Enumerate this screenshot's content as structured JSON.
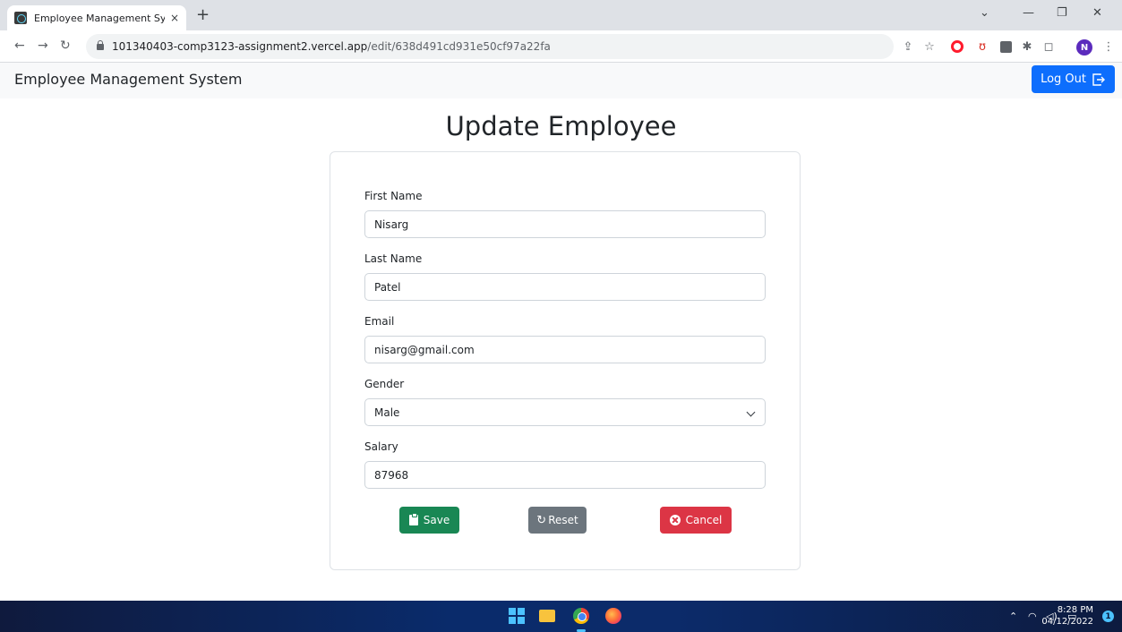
{
  "browser": {
    "tab_title": "Employee Management System",
    "tab_close": "×",
    "new_tab": "+",
    "url_host": "101340403-comp3123-assignment2.vercel.app",
    "url_path": "/edit/638d491cd931e50cf97a22fa",
    "profile_initial": "N",
    "icons": [
      "react-favicon-icon",
      "lock-icon",
      "share-icon",
      "star-icon",
      "opera-icon",
      "extension-icon",
      "puzzle-icon",
      "sidebar-icon"
    ]
  },
  "navbar": {
    "brand": "Employee Management System",
    "logout_label": "Log Out",
    "logout_color": "#0d6efd"
  },
  "page": {
    "title": "Update Employee"
  },
  "form": {
    "first_name": {
      "label": "First Name",
      "value": "Nisarg"
    },
    "last_name": {
      "label": "Last Name",
      "value": "Patel"
    },
    "email": {
      "label": "Email",
      "value": "nisarg@gmail.com"
    },
    "gender": {
      "label": "Gender",
      "value": "Male"
    },
    "salary": {
      "label": "Salary",
      "value": "87968"
    }
  },
  "buttons": {
    "save": {
      "label": "Save",
      "color": "#198754"
    },
    "reset": {
      "label": "Reset",
      "color": "#6c757d"
    },
    "cancel": {
      "label": "Cancel",
      "color": "#dc3545"
    }
  },
  "taskbar": {
    "time": "8:28 PM",
    "date": "04/12/2022",
    "notification_count": "1"
  }
}
